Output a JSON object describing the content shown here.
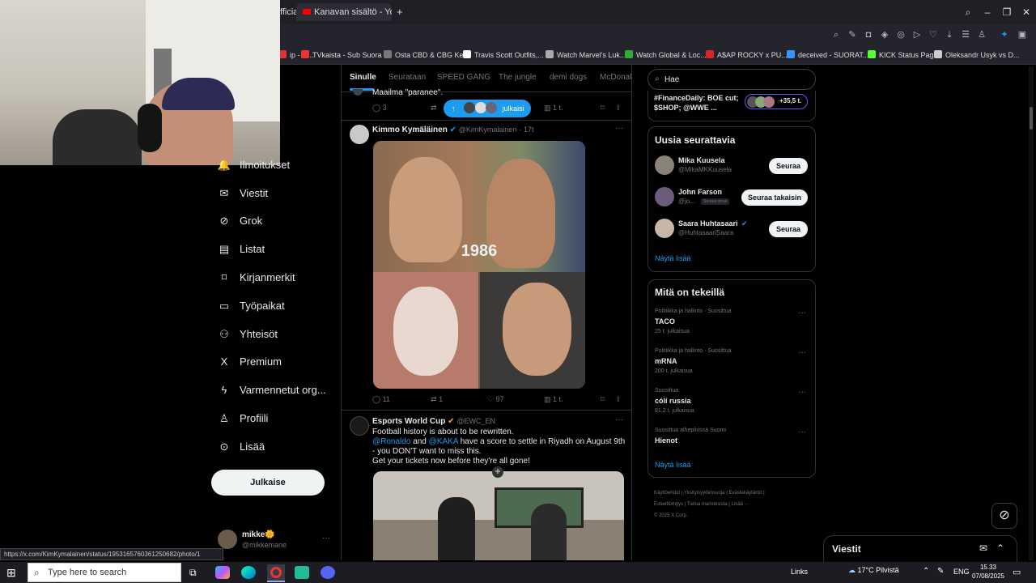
{
  "browser": {
    "tabs": [
      {
        "label": "fficial"
      },
      {
        "label": "Kanavan sisältö - YouTube"
      }
    ],
    "new_tab_symbol": "+",
    "bookmarks": [
      {
        "label": "ip - G...",
        "color": "#d33"
      },
      {
        "label": "TVkaista - Sub Suora",
        "color": "#e33"
      },
      {
        "label": "Osta CBD & CBG Ke...",
        "color": "#777"
      },
      {
        "label": "Travis Scott Outfits,...",
        "color": "#fff"
      },
      {
        "label": "Watch Marvel's Luk...",
        "color": "#aaa"
      },
      {
        "label": "Watch Global & Loc...",
        "color": "#3a3"
      },
      {
        "label": "A$AP ROCKY x PU...",
        "color": "#d22"
      },
      {
        "label": "deceived - SUORAT...",
        "color": "#39f"
      },
      {
        "label": "KICK Status Page",
        "color": "#5f3"
      },
      {
        "label": "Oleksandr Usyk vs D...",
        "color": "#ccc"
      }
    ]
  },
  "sidebar": {
    "items": [
      {
        "label": "Ilmoitukset",
        "icon": "bell-icon"
      },
      {
        "label": "Viestit",
        "icon": "envelope-icon"
      },
      {
        "label": "Grok",
        "icon": "grok-icon"
      },
      {
        "label": "Listat",
        "icon": "list-icon"
      },
      {
        "label": "Kirjanmerkit",
        "icon": "bookmark-icon"
      },
      {
        "label": "Työpaikat",
        "icon": "briefcase-icon"
      },
      {
        "label": "Yhteisöt",
        "icon": "people-icon"
      },
      {
        "label": "Premium",
        "icon": "x-logo-icon"
      },
      {
        "label": "Varmennetut org...",
        "icon": "lightning-icon"
      },
      {
        "label": "Profiili",
        "icon": "person-icon"
      },
      {
        "label": "Lisää",
        "icon": "more-circle-icon"
      }
    ],
    "post_button": "Julkaise",
    "account": {
      "name": "mikke🌼",
      "handle": "@mikkemane"
    }
  },
  "feed": {
    "tabs": [
      "Sinulle",
      "Seurataan",
      "SPEED GANG",
      "The jungle",
      "demi dogs",
      "McDonal"
    ],
    "prev_tweet": {
      "text_fragment": "Maailma \"paranee\".",
      "replies": "3",
      "new_posts_label": "julkaisi",
      "views": "1 t."
    },
    "tweets": [
      {
        "name": "Kimmo Kymäläinen",
        "handle": "@KimKymalainen",
        "time": "17t",
        "image_caption": "1986",
        "replies": "11",
        "retweets": "1",
        "likes": "97",
        "views": "1 t."
      },
      {
        "name": "Esports World Cup",
        "handle": "@EWC_EN",
        "time": "",
        "line1": "Football history is about to be rewritten.",
        "mention1": "@Ronaldo",
        "and_word": "and",
        "mention2": "@KAKA",
        "line2": "have a score to settle in Riyadh on August 9th - you DON'T want to miss this.",
        "line3": "Get your tickets now before they're all gone!"
      }
    ]
  },
  "right": {
    "search_placeholder": "Hae",
    "trending_top": {
      "text": "#FinanceDaily: BOE cut; $SHOP; @WWE ...",
      "count": "+35,5 t."
    },
    "who_to_follow": {
      "title": "Uusia seurattavia",
      "users": [
        {
          "name": "Mika Kuusela",
          "handle": "@MikaMKKuusela",
          "button": "Seuraa",
          "badge": ""
        },
        {
          "name": "John Farson",
          "handle": "@jo...",
          "button": "Seuraa takaisin",
          "badge": "Seuraa sinua"
        },
        {
          "name": "Saara Huhtasaari",
          "handle": "@HuhtasaariSaara",
          "button": "Seuraa",
          "badge": ""
        }
      ],
      "show_more": "Näytä lisää"
    },
    "trends": {
      "title": "Mitä on tekeillä",
      "items": [
        {
          "category": "Politiikka ja hallinto · Suosittua",
          "name": "TACO",
          "count": "25 t. julkaisua"
        },
        {
          "category": "Politiikka ja hallinto · Suosittua",
          "name": "mRNA",
          "count": "200 t. julkaisua"
        },
        {
          "category": "Suosittua",
          "name": "cólí russia",
          "count": "81,2 t. julkaisua"
        },
        {
          "category": "Suosittua aihepiirissä Suomi",
          "name": "Hienot",
          "count": ""
        }
      ],
      "show_more": "Näytä lisää"
    },
    "footer": [
      "Käyttöehdot",
      "Yksityisyydensuoja",
      "Evästekäytäntö",
      "Esteettömyys",
      "Tietoa mainoksista",
      "Lisää ···",
      "© 2025 X Corp."
    ],
    "messages_panel": "Viestit"
  },
  "status_url": "https://x.com/KimKymalainen/status/1953165760361250682/photo/1",
  "taskbar": {
    "search_placeholder": "Type here to search",
    "links": "Links",
    "weather": "17°C  Pilvistä",
    "lang": "ENG",
    "time": "15.33",
    "date": "07/08/2025"
  }
}
